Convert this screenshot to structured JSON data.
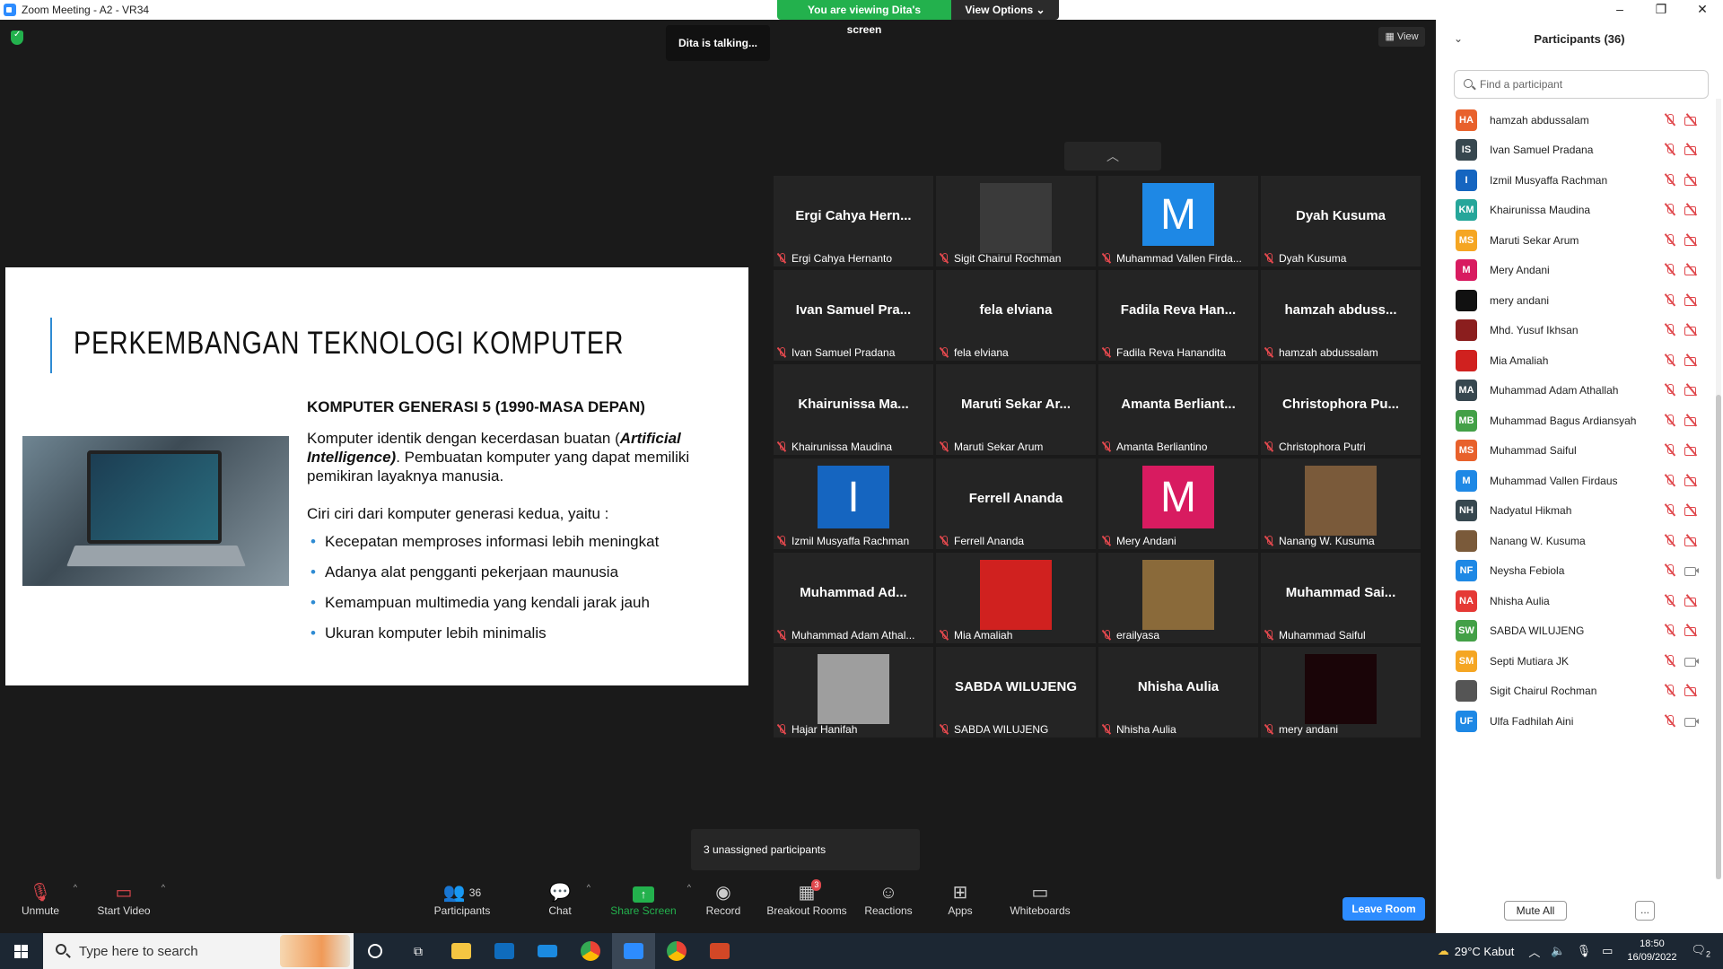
{
  "window": {
    "title": "Zoom Meeting - A2 - VR34",
    "viewing_banner": "You are viewing Dita's screen",
    "view_options": "View Options"
  },
  "stage": {
    "talking": "Dita is talking...",
    "view_button": "View",
    "unassigned": "3 unassigned participants"
  },
  "slide": {
    "title": "PERKEMBANGAN TEKNOLOGI KOMPUTER",
    "subtitle": "KOMPUTER GENERASI 5 (1990-MASA DEPAN)",
    "para_start": "Komputer identik dengan kecerdasan buatan (",
    "para_em": "Artificial Intelligence)",
    "para_end": ". Pembuatan komputer yang dapat memiliki pemikiran layaknya manusia.",
    "para2": "Ciri ciri dari komputer generasi kedua, yaitu :",
    "bullets": [
      "Kecepatan memproses informasi lebih meningkat",
      "Adanya alat pengganti pekerjaan maunusia",
      "Kemampuan multimedia yang kendali jarak jauh",
      "Ukuran komputer lebih minimalis"
    ]
  },
  "tiles": [
    {
      "big": "Ergi Cahya Hern...",
      "label": "Ergi Cahya Hernanto",
      "kind": "text"
    },
    {
      "big": "",
      "label": "Sigit Chairul Rochman",
      "kind": "photo",
      "photo_color": "#3a3a3a"
    },
    {
      "big": "M",
      "label": "Muhammad Vallen Firda...",
      "kind": "avatar",
      "color": "#1e88e5"
    },
    {
      "big": "Dyah Kusuma",
      "label": "Dyah Kusuma",
      "kind": "text"
    },
    {
      "big": "Ivan Samuel Pra...",
      "label": "Ivan Samuel Pradana",
      "kind": "text"
    },
    {
      "big": "fela elviana",
      "label": "fela elviana",
      "kind": "text"
    },
    {
      "big": "Fadila Reva Han...",
      "label": "Fadila Reva Hanandita",
      "kind": "text"
    },
    {
      "big": "hamzah abduss...",
      "label": "hamzah abdussalam",
      "kind": "text"
    },
    {
      "big": "Khairunissa Ma...",
      "label": "Khairunissa Maudina",
      "kind": "text"
    },
    {
      "big": "Maruti Sekar Ar...",
      "label": "Maruti Sekar Arum",
      "kind": "text"
    },
    {
      "big": "Amanta Berliant...",
      "label": "Amanta Berliantino",
      "kind": "text"
    },
    {
      "big": "Christophora Pu...",
      "label": "Christophora Putri",
      "kind": "text"
    },
    {
      "big": "I",
      "label": "Izmil Musyaffa Rachman",
      "kind": "avatar",
      "color": "#1565c0"
    },
    {
      "big": "Ferrell Ananda",
      "label": "Ferrell Ananda",
      "kind": "text"
    },
    {
      "big": "M",
      "label": "Mery Andani",
      "kind": "avatar",
      "color": "#d81b60"
    },
    {
      "big": "",
      "label": "Nanang W. Kusuma",
      "kind": "photo",
      "photo_color": "#7a5a3a"
    },
    {
      "big": "Muhammad Ad...",
      "label": "Muhammad Adam Athal...",
      "kind": "text"
    },
    {
      "big": "",
      "label": "Mia Amaliah",
      "kind": "photo",
      "photo_color": "#d0211f"
    },
    {
      "big": "",
      "label": "erailyasa",
      "kind": "photo",
      "photo_color": "#8a6a3a"
    },
    {
      "big": "Muhammad Sai...",
      "label": "Muhammad Saiful",
      "kind": "text"
    },
    {
      "big": "",
      "label": "Hajar Hanifah",
      "kind": "photo",
      "photo_color": "#9e9e9e"
    },
    {
      "big": "SABDA WILUJENG",
      "label": "SABDA WILUJENG",
      "kind": "text"
    },
    {
      "big": "Nhisha Aulia",
      "label": "Nhisha Aulia",
      "kind": "text"
    },
    {
      "big": "",
      "label": "mery andani",
      "kind": "photo",
      "photo_color": "#1a0508"
    }
  ],
  "toolbar": {
    "unmute": "Unmute",
    "start_video": "Start Video",
    "participants": "Participants",
    "participants_count": "36",
    "chat": "Chat",
    "share_screen": "Share Screen",
    "record": "Record",
    "breakout": "Breakout Rooms",
    "breakout_badge": "3",
    "reactions": "Reactions",
    "apps": "Apps",
    "whiteboards": "Whiteboards",
    "leave": "Leave Room"
  },
  "panel": {
    "title": "Participants (36)",
    "search_placeholder": "Find a participant",
    "mute_all": "Mute All",
    "more": "...",
    "participants": [
      {
        "initials": "HA",
        "name": "hamzah abdussalam",
        "color": "#e8612c",
        "cam": "off"
      },
      {
        "initials": "IS",
        "name": "Ivan Samuel Pradana",
        "color": "#37474f",
        "cam": "off"
      },
      {
        "initials": "I",
        "name": "Izmil Musyaffa Rachman",
        "color": "#1565c0",
        "cam": "off"
      },
      {
        "initials": "KM",
        "name": "Khairunissa Maudina",
        "color": "#26a69a",
        "cam": "off"
      },
      {
        "initials": "MS",
        "name": "Maruti Sekar Arum",
        "color": "#f5a623",
        "cam": "off"
      },
      {
        "initials": "M",
        "name": "Mery Andani",
        "color": "#d81b60",
        "cam": "off"
      },
      {
        "initials": "",
        "name": "mery andani",
        "color": "#111111",
        "cam": "off"
      },
      {
        "initials": "",
        "name": "Mhd. Yusuf Ikhsan",
        "color": "#8b1e1e",
        "cam": "off"
      },
      {
        "initials": "",
        "name": "Mia Amaliah",
        "color": "#d0211f",
        "cam": "off"
      },
      {
        "initials": "MA",
        "name": "Muhammad Adam Athallah",
        "color": "#37474f",
        "cam": "off"
      },
      {
        "initials": "MB",
        "name": "Muhammad Bagus Ardiansyah",
        "color": "#43a047",
        "cam": "off"
      },
      {
        "initials": "MS",
        "name": "Muhammad Saiful",
        "color": "#e8612c",
        "cam": "off"
      },
      {
        "initials": "M",
        "name": "Muhammad Vallen Firdaus",
        "color": "#1e88e5",
        "cam": "off"
      },
      {
        "initials": "NH",
        "name": "Nadyatul Hikmah",
        "color": "#37474f",
        "cam": "off"
      },
      {
        "initials": "",
        "name": "Nanang W. Kusuma",
        "color": "#7a5a3a",
        "cam": "off"
      },
      {
        "initials": "NF",
        "name": "Neysha Febiola",
        "color": "#1e88e5",
        "cam": "on"
      },
      {
        "initials": "NA",
        "name": "Nhisha Aulia",
        "color": "#e53935",
        "cam": "off"
      },
      {
        "initials": "SW",
        "name": "SABDA WILUJENG",
        "color": "#43a047",
        "cam": "off"
      },
      {
        "initials": "SM",
        "name": "Septi Mutiara JK",
        "color": "#f5a623",
        "cam": "on"
      },
      {
        "initials": "",
        "name": "Sigit Chairul Rochman",
        "color": "#555555",
        "cam": "off"
      },
      {
        "initials": "UF",
        "name": "Ulfa Fadhilah Aini",
        "color": "#1e88e5",
        "cam": "on"
      }
    ]
  },
  "taskbar": {
    "search": "Type here to search",
    "weather": "29°C  Kabut",
    "time": "18:50",
    "date": "16/09/2022",
    "notif": "2"
  }
}
